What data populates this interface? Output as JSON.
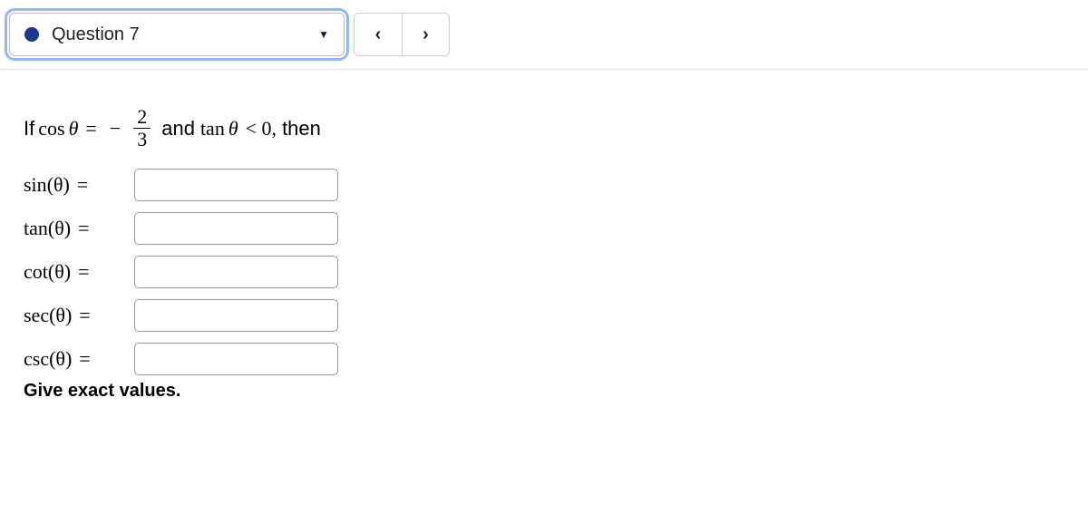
{
  "header": {
    "question_label": "Question 7"
  },
  "problem": {
    "if_text": "If",
    "func1": "cos",
    "var": "θ",
    "equals": "=",
    "minus": "−",
    "frac_num": "2",
    "frac_den": "3",
    "and_text": "and",
    "func2": "tan",
    "comparison": "< 0,",
    "then_text": "then"
  },
  "answers": [
    {
      "func": "sin",
      "arg": "(θ)",
      "value": ""
    },
    {
      "func": "tan",
      "arg": "(θ)",
      "value": ""
    },
    {
      "func": "cot",
      "arg": "(θ)",
      "value": ""
    },
    {
      "func": "sec",
      "arg": "(θ)",
      "value": ""
    },
    {
      "func": "csc",
      "arg": "(θ)",
      "value": ""
    }
  ],
  "instruction": "Give exact values."
}
